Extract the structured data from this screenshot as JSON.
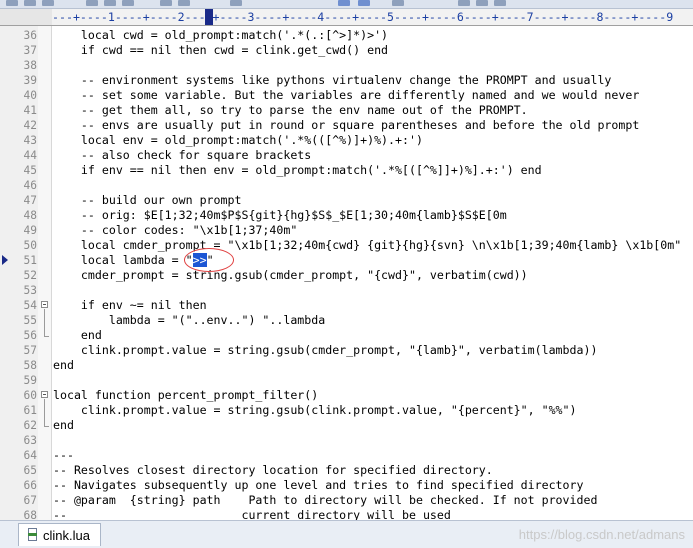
{
  "ruler": {
    "text": "---+----1----+----2----+----3----+----4----+----5----+----6----+----7----+----8----+----9"
  },
  "editor": {
    "current_line": "51",
    "lines": [
      {
        "num": "36",
        "code": "    local cwd = old_prompt:match('.*(.:[^>]*)>')"
      },
      {
        "num": "37",
        "code": "    if cwd == nil then cwd = clink.get_cwd() end"
      },
      {
        "num": "38",
        "code": ""
      },
      {
        "num": "39",
        "code": "    -- environment systems like pythons virtualenv change the PROMPT and usually"
      },
      {
        "num": "40",
        "code": "    -- set some variable. But the variables are differently named and we would never"
      },
      {
        "num": "41",
        "code": "    -- get them all, so try to parse the env name out of the PROMPT."
      },
      {
        "num": "42",
        "code": "    -- envs are usually put in round or square parentheses and before the old prompt"
      },
      {
        "num": "43",
        "code": "    local env = old_prompt:match('.*%(([^%)]+)%).+:')"
      },
      {
        "num": "44",
        "code": "    -- also check for square brackets"
      },
      {
        "num": "45",
        "code": "    if env == nil then env = old_prompt:match('.*%[([^%]]+)%].+:') end"
      },
      {
        "num": "46",
        "code": ""
      },
      {
        "num": "47",
        "code": "    -- build our own prompt"
      },
      {
        "num": "48",
        "code": "    -- orig: $E[1;32;40m$P$S{git}{hg}$S$_$E[1;30;40m{lamb}$S$E[0m"
      },
      {
        "num": "49",
        "code": "    -- color codes: \"\\x1b[1;37;40m\""
      },
      {
        "num": "50",
        "code": "    local cmder_prompt = \"\\x1b[1;32;40m{cwd} {git}{hg}{svn} \\n\\x1b[1;39;40m{lamb} \\x1b[0m\""
      },
      {
        "num": "51",
        "code": "    local lambda = \"",
        "selected": ">>",
        "after": "\""
      },
      {
        "num": "52",
        "code": "    cmder_prompt = string.gsub(cmder_prompt, \"{cwd}\", verbatim(cwd))"
      },
      {
        "num": "53",
        "code": ""
      },
      {
        "num": "54",
        "code": "    if env ~= nil then"
      },
      {
        "num": "55",
        "code": "        lambda = \"(\"..env..\") \"..lambda"
      },
      {
        "num": "56",
        "code": "    end"
      },
      {
        "num": "57",
        "code": "    clink.prompt.value = string.gsub(cmder_prompt, \"{lamb}\", verbatim(lambda))"
      },
      {
        "num": "58",
        "code": "end"
      },
      {
        "num": "59",
        "code": ""
      },
      {
        "num": "60",
        "code": "local function percent_prompt_filter()"
      },
      {
        "num": "61",
        "code": "    clink.prompt.value = string.gsub(clink.prompt.value, \"{percent}\", \"%%\")"
      },
      {
        "num": "62",
        "code": "end"
      },
      {
        "num": "63",
        "code": ""
      },
      {
        "num": "64",
        "code": "---"
      },
      {
        "num": "65",
        "code": "-- Resolves closest directory location for specified directory."
      },
      {
        "num": "66",
        "code": "-- Navigates subsequently up one level and tries to find specified directory"
      },
      {
        "num": "67",
        "code": "-- @param  {string} path    Path to directory will be checked. If not provided"
      },
      {
        "num": "68",
        "code": "--                         current directory will be used"
      }
    ]
  },
  "tabs": [
    {
      "label": "clink.lua",
      "icon": "lua-file-icon"
    }
  ],
  "watermark": "https://blog.csdn.net/admans",
  "colors": {
    "selection": "#1c56d4",
    "annotation_circle": "#e04040",
    "ruler_text": "#1b3fa3"
  }
}
